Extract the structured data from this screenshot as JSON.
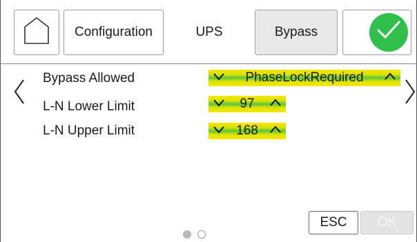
{
  "header": {
    "home_icon": "home-icon",
    "tabs": [
      {
        "label": "Configuration"
      },
      {
        "label": "UPS"
      },
      {
        "label": "Bypass"
      }
    ],
    "confirm_icon": "checkmark-icon"
  },
  "settings": {
    "rows": [
      {
        "label": "Bypass Allowed",
        "value": "PhaseLockRequired"
      },
      {
        "label": "L-N Lower Limit",
        "value": "97"
      },
      {
        "label": "L-N Upper Limit",
        "value": "168"
      }
    ]
  },
  "footer": {
    "esc_label": "ESC",
    "ok_label": "OK",
    "page_indicator": {
      "current": 1,
      "total": 2
    }
  },
  "colors": {
    "confirm": "#2fbf4a",
    "spinner_yellow": "#f6e700",
    "spinner_green": "#58c63e"
  }
}
